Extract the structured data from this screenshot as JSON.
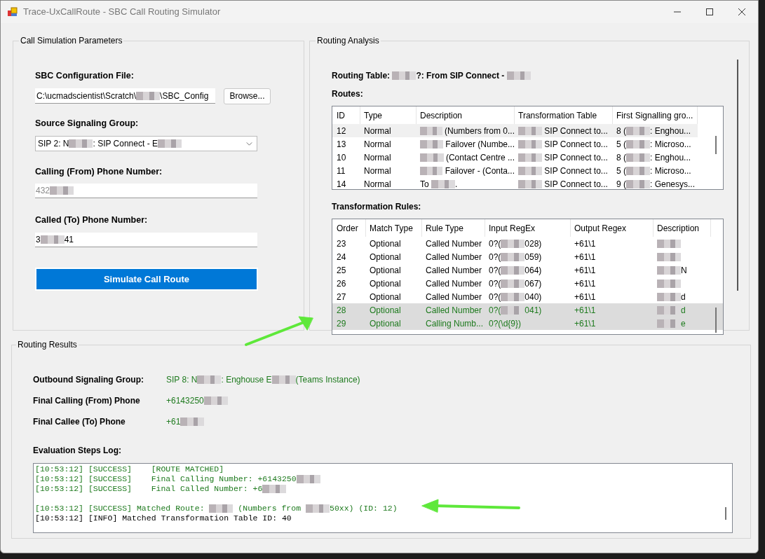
{
  "window": {
    "title": "Trace-UxCallRoute - SBC Call Routing Simulator"
  },
  "parameters": {
    "legend": "Call Simulation Parameters",
    "config_label": "SBC Configuration File:",
    "config_value": [
      "C:\\ucmadscientist\\Scratch\\",
      {
        "kind": "redacted"
      },
      "\\SBC_Config"
    ],
    "browse_button": "Browse...",
    "source_label": "Source Signaling Group:",
    "source_value": [
      "SIP 2: N",
      {
        "kind": "redacted"
      },
      ": SIP Connect - E",
      {
        "kind": "redacted"
      }
    ],
    "calling_label": "Calling (From) Phone Number:",
    "calling_placeholder": [
      "432",
      {
        "kind": "redacted"
      }
    ],
    "called_label": "Called (To) Phone Number:",
    "called_value": [
      "3",
      {
        "kind": "redacted"
      },
      "41"
    ],
    "simulate_button": "Simulate Call Route"
  },
  "analysis": {
    "legend": "Routing Analysis",
    "routing_table": [
      "Routing Table: ",
      {
        "kind": "redacted"
      },
      "?: From SIP Connect - ",
      {
        "kind": "redacted"
      }
    ],
    "routes_label": "Routes:",
    "routes": {
      "columns": [
        "ID",
        "Type",
        "Description",
        "Transformation Table",
        "First Signalling gro..."
      ],
      "rows": [
        {
          "selected": true,
          "cells": [
            "12",
            "Normal",
            [
              {
                "kind": "redacted"
              },
              " (Numbers from 0..."
            ],
            [
              {
                "kind": "redacted"
              },
              " SIP Connect to..."
            ],
            [
              "8 (",
              {
                "kind": "redacted"
              },
              ": Enghou..."
            ]
          ]
        },
        {
          "selected": false,
          "cells": [
            "13",
            "Normal",
            [
              {
                "kind": "redacted"
              },
              " Failover (Numbe..."
            ],
            [
              {
                "kind": "redacted"
              },
              " SIP Connect to..."
            ],
            [
              "5 (",
              {
                "kind": "redacted"
              },
              ": Microso..."
            ]
          ]
        },
        {
          "selected": false,
          "cells": [
            "10",
            "Normal",
            [
              {
                "kind": "redacted"
              },
              " (Contact Centre ..."
            ],
            [
              {
                "kind": "redacted"
              },
              " SIP Connect to..."
            ],
            [
              "8 (",
              {
                "kind": "redacted"
              },
              ": Enghou..."
            ]
          ]
        },
        {
          "selected": false,
          "cells": [
            "11",
            "Normal",
            [
              {
                "kind": "redacted"
              },
              " Failover - (Conta..."
            ],
            [
              {
                "kind": "redacted"
              },
              " SIP Connect to..."
            ],
            [
              "5 (",
              {
                "kind": "redacted"
              },
              ": Microso..."
            ]
          ]
        },
        {
          "selected": false,
          "cells": [
            "14",
            "Normal",
            [
              "To ",
              {
                "kind": "redacted"
              },
              "."
            ],
            [
              {
                "kind": "redacted"
              },
              " SIP Connect to..."
            ],
            [
              "9 (",
              {
                "kind": "redacted"
              },
              ": Genesys..."
            ]
          ]
        }
      ]
    },
    "rules_label": "Transformation Rules:",
    "rules": {
      "columns": [
        "Order",
        "Match Type",
        "Rule Type",
        "Input RegEx",
        "Output Regex",
        "Description"
      ],
      "rows": [
        {
          "matched": false,
          "cells": [
            "23",
            "Optional",
            "Called Number",
            [
              "0?(",
              {
                "kind": "redacted"
              },
              "028)"
            ],
            "+61\\1",
            [
              {
                "kind": "redacted"
              }
            ]
          ]
        },
        {
          "matched": false,
          "cells": [
            "24",
            "Optional",
            "Called Number",
            [
              "0?(",
              {
                "kind": "redacted"
              },
              "059)"
            ],
            "+61\\1",
            [
              {
                "kind": "redacted"
              }
            ]
          ]
        },
        {
          "matched": false,
          "cells": [
            "25",
            "Optional",
            "Called Number",
            [
              "0?(",
              {
                "kind": "redacted"
              },
              "064)"
            ],
            "+61\\1",
            [
              {
                "kind": "redacted"
              },
              "N"
            ]
          ]
        },
        {
          "matched": false,
          "cells": [
            "26",
            "Optional",
            "Called Number",
            [
              "0?(",
              {
                "kind": "redacted"
              },
              "067)"
            ],
            "+61\\1",
            [
              {
                "kind": "redacted"
              }
            ]
          ]
        },
        {
          "matched": false,
          "cells": [
            "27",
            "Optional",
            "Called Number",
            [
              "0?(",
              {
                "kind": "redacted"
              },
              "040)"
            ],
            "+61\\1",
            [
              {
                "kind": "redacted"
              },
              "d"
            ]
          ]
        },
        {
          "matched": true,
          "cells": [
            "28",
            "Optional",
            "Called Number",
            [
              "0?(",
              {
                "kind": "redacted"
              },
              "041)"
            ],
            "+61\\1",
            [
              {
                "kind": "redacted"
              },
              "d"
            ]
          ]
        },
        {
          "matched": true,
          "cells": [
            "29",
            "Optional",
            "Calling Numb...",
            "0?(\\d{9})",
            "+61\\1",
            [
              {
                "kind": "redacted"
              },
              "e"
            ]
          ]
        }
      ]
    }
  },
  "results": {
    "legend": "Routing Results",
    "fields": [
      {
        "label": "Outbound Signaling Group:",
        "value": [
          "SIP 8: N",
          {
            "kind": "redacted"
          },
          ": Enghouse E",
          {
            "kind": "redacted"
          },
          "(Teams Instance)"
        ]
      },
      {
        "label": "Final Calling (From) Phone",
        "value": [
          "+6143250",
          {
            "kind": "redacted"
          }
        ]
      },
      {
        "label": "Final Callee (To) Phone",
        "value": [
          "+61",
          {
            "kind": "redacted"
          }
        ]
      }
    ],
    "log_label": "Evaluation Steps Log:",
    "log": [
      {
        "kind": "success",
        "text": [
          "[10:53:12] [SUCCESS]    [ROUTE MATCHED]"
        ]
      },
      {
        "kind": "success",
        "text": [
          "[10:53:12] [SUCCESS]    Final Calling Number: +6143250",
          {
            "kind": "redacted"
          }
        ]
      },
      {
        "kind": "success",
        "text": [
          "[10:53:12] [SUCCESS]    Final Called Number: +6",
          {
            "kind": "redacted"
          }
        ]
      },
      {
        "kind": "blank"
      },
      {
        "kind": "success",
        "text": [
          "[10:53:12] [SUCCESS] Matched Route: ",
          {
            "kind": "redacted"
          },
          " (Numbers from ",
          {
            "kind": "redacted"
          },
          "50xx) (ID: 12)"
        ]
      },
      {
        "kind": "info",
        "text": [
          "[10:53:12] [INFO] Matched Transformation Table ID: 40"
        ]
      }
    ]
  }
}
